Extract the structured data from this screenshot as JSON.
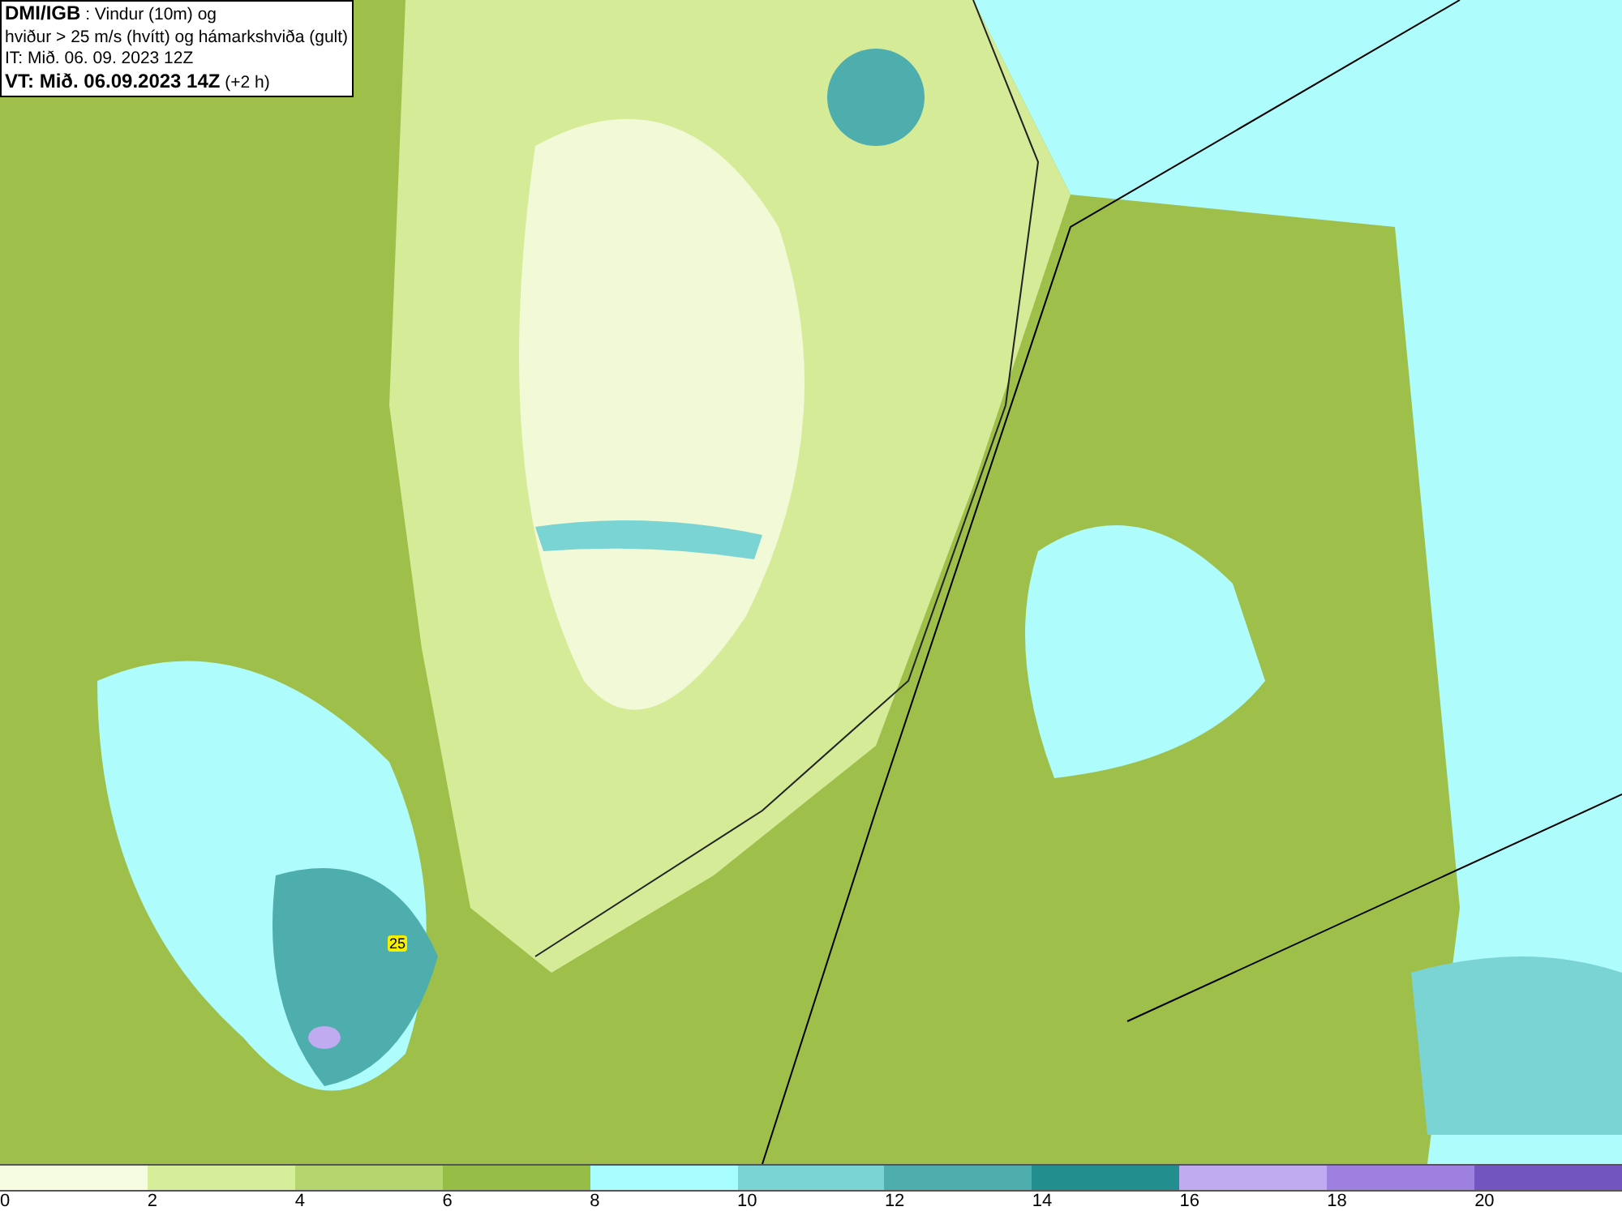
{
  "title_box": {
    "lines": [
      "**DMI/IGB** : Vindur (10m) og",
      "hviður > 25 m/s (hvítt) og hámarkshviða (gult)",
      "IT: Mið. 06. 09. 2023 12Z",
      "**VT: Mið. 06.09.2023 14Z** (+2 h)"
    ]
  },
  "gust_label": "25",
  "legend": [
    {
      "label": "0",
      "color": "#f5fce0"
    },
    {
      "label": "2",
      "color": "#d6ed9a"
    },
    {
      "label": "4",
      "color": "#b5d66e"
    },
    {
      "label": "6",
      "color": "#96bd45"
    },
    {
      "label": "8",
      "color": "#a8fefe"
    },
    {
      "label": "10",
      "color": "#7ad4d4"
    },
    {
      "label": "12",
      "color": "#4eaeae"
    },
    {
      "label": "14",
      "color": "#238e8e"
    },
    {
      "label": "16",
      "color": "#c0aaf0"
    },
    {
      "label": "18",
      "color": "#9d80e0"
    },
    {
      "label": "20",
      "color": "#7355c0"
    }
  ]
}
